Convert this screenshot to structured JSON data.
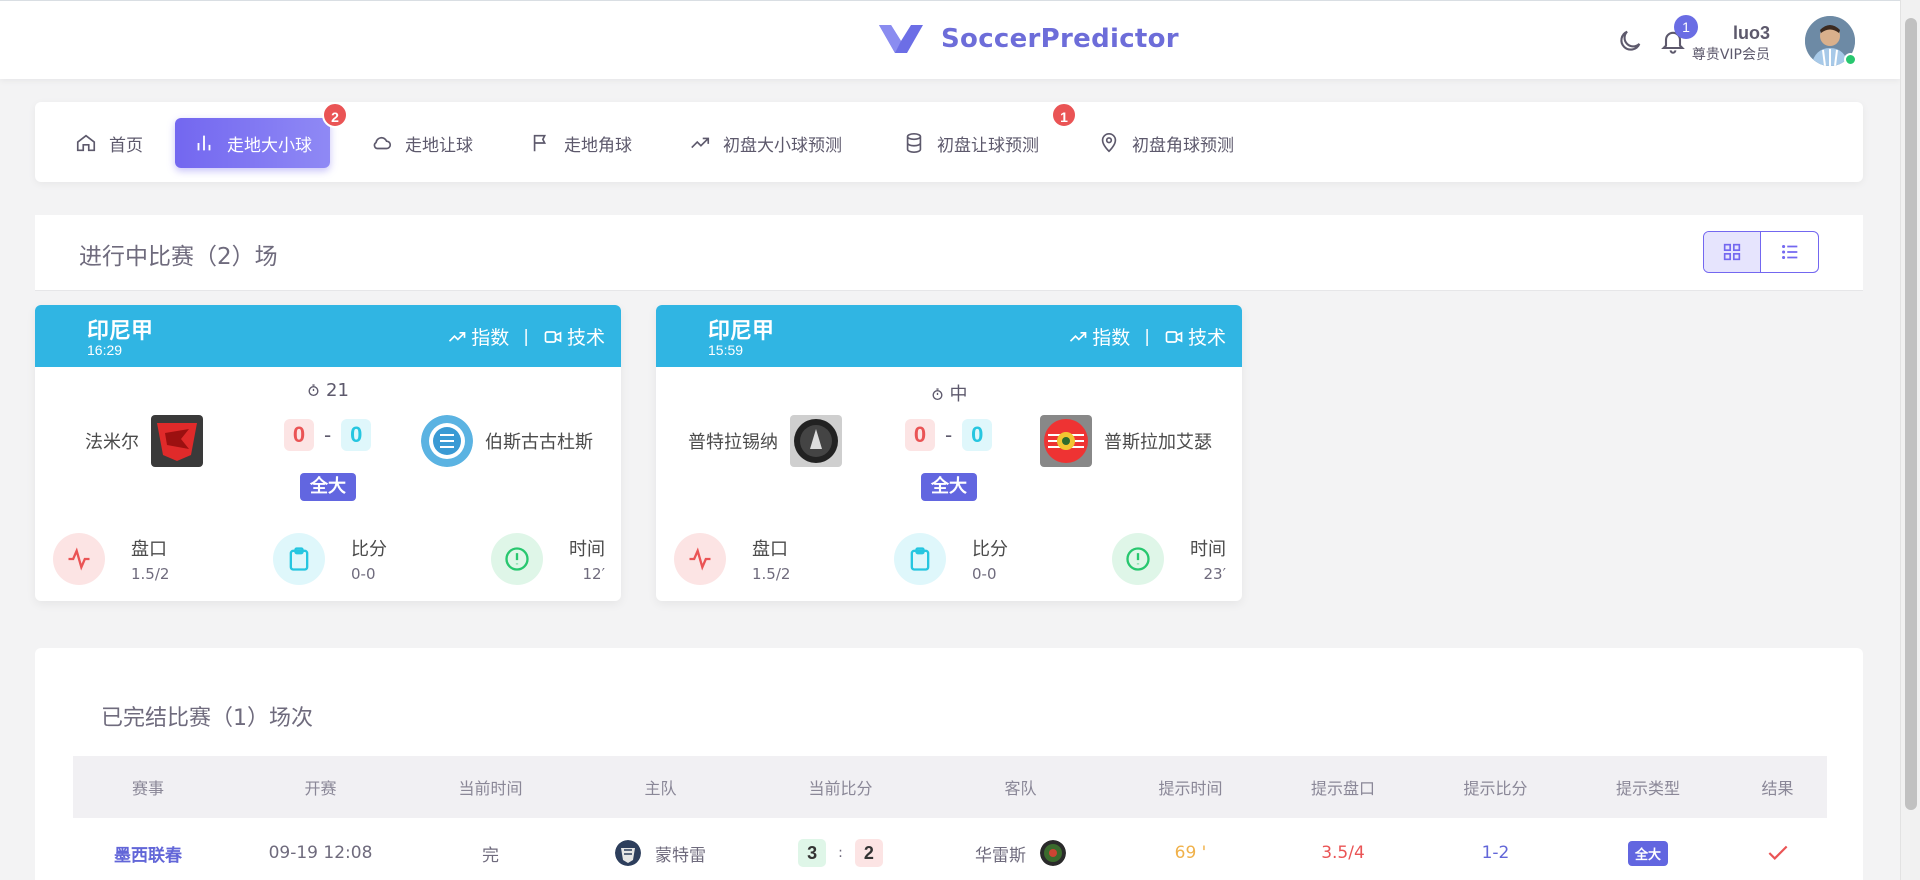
{
  "app": {
    "brand_name": "SoccerPredictor",
    "accent": "#7367f0",
    "header_blue": "#30b5e3"
  },
  "user": {
    "name": "luo3",
    "role": "尊贵VIP会员",
    "notifications": "1"
  },
  "nav": {
    "items": [
      {
        "label": "首页",
        "icon": "home-icon"
      },
      {
        "label": "走地大小球",
        "icon": "bar-chart-icon",
        "active": true,
        "badge": "2"
      },
      {
        "label": "走地让球",
        "icon": "cloud-icon"
      },
      {
        "label": "走地角球",
        "icon": "flag-icon"
      },
      {
        "label": "初盘大小球预测",
        "icon": "trending-up-icon"
      },
      {
        "label": "初盘让球预测",
        "icon": "database-icon",
        "badge": "1"
      },
      {
        "label": "初盘角球预测",
        "icon": "map-pin-icon"
      }
    ]
  },
  "live": {
    "title": "进行中比赛（2）场",
    "matches": [
      {
        "league": "印尼甲",
        "time": "16:29",
        "link_index": "指数",
        "link_tech": "技术",
        "sep": "|",
        "minute": "21",
        "home": "法米尔",
        "away": "伯斯古古杜斯",
        "home_score": "0",
        "dash": "-",
        "away_score": "0",
        "tag": "全大",
        "stat_handicap_label": "盘口",
        "stat_handicap": "1.5/2",
        "stat_score_label": "比分",
        "stat_score": "0-0",
        "stat_time_label": "时间",
        "stat_time": "12′"
      },
      {
        "league": "印尼甲",
        "time": "15:59",
        "link_index": "指数",
        "link_tech": "技术",
        "sep": "|",
        "minute": "中",
        "home": "普特拉锡纳",
        "away": "普斯拉加艾瑟",
        "home_score": "0",
        "dash": "-",
        "away_score": "0",
        "tag": "全大",
        "stat_handicap_label": "盘口",
        "stat_handicap": "1.5/2",
        "stat_score_label": "比分",
        "stat_score": "0-0",
        "stat_time_label": "时间",
        "stat_time": "23′"
      }
    ]
  },
  "finished": {
    "title": "已完结比赛（1）场次",
    "columns": [
      "赛事",
      "开赛",
      "当前时间",
      "主队",
      "当前比分",
      "客队",
      "提示时间",
      "提示盘口",
      "提示比分",
      "提示类型",
      "结果"
    ],
    "rows": [
      {
        "league": "墨西联春",
        "start": "09-19 12:08",
        "status": "完",
        "home": "蒙特雷",
        "home_score": "3",
        "colon": ":",
        "away_score": "2",
        "away": "华雷斯",
        "tip_time": "69 '",
        "tip_handicap": "3.5/4",
        "tip_score": "1-2",
        "tip_type": "全大",
        "result_icon": "check-icon"
      }
    ]
  }
}
